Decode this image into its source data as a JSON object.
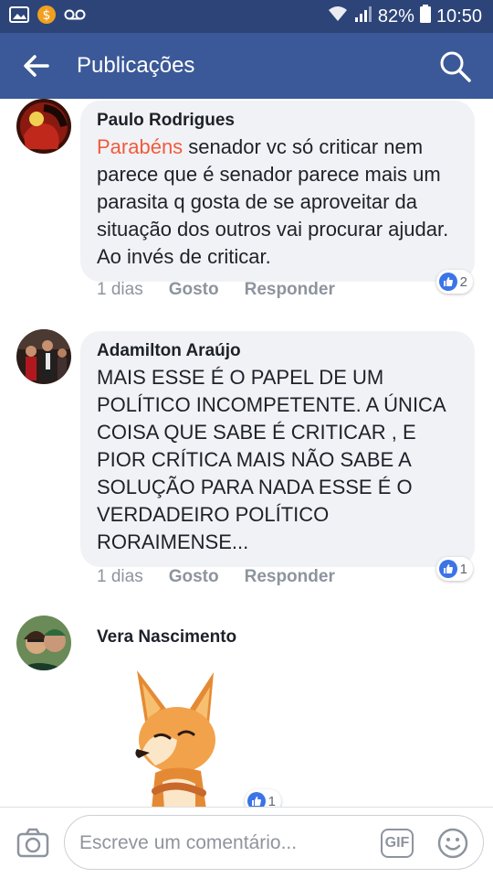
{
  "statusbar": {
    "battery": "82%",
    "time": "10:50"
  },
  "header": {
    "title": "Publicações"
  },
  "comments": [
    {
      "author": "Paulo Rodrigues",
      "tag": "Parabéns",
      "text": " senador vc só criticar nem parece que é senador parece mais um parasita q gosta de se aproveitar da situação dos outros vai procurar ajudar. Ao invés de criticar.",
      "time": "1 dias",
      "like": "Gosto",
      "reply": "Responder",
      "reactions": "2"
    },
    {
      "author": "Adamilton Araújo",
      "text": "MAIS ESSE É O PAPEL DE UM POLÍTICO INCOMPETENTE. A ÚNICA COISA QUE SABE É  CRITICAR , E PIOR CRÍTICA MAIS NÃO SABE A SOLUÇÃO PARA NADA ESSE É O VERDADEIRO POLÍTICO RORAIMENSE...",
      "time": "1 dias",
      "like": "Gosto",
      "reply": "Responder",
      "reactions": "1"
    },
    {
      "author": "Vera Nascimento",
      "reactions": "1"
    }
  ],
  "composer": {
    "placeholder": "Escreve um comentário...",
    "gif": "GIF"
  },
  "colors": {
    "brand": "#3b5998",
    "statusbar": "#2c4478",
    "tag": "#f05a3c",
    "bubble": "#f1f2f5"
  }
}
